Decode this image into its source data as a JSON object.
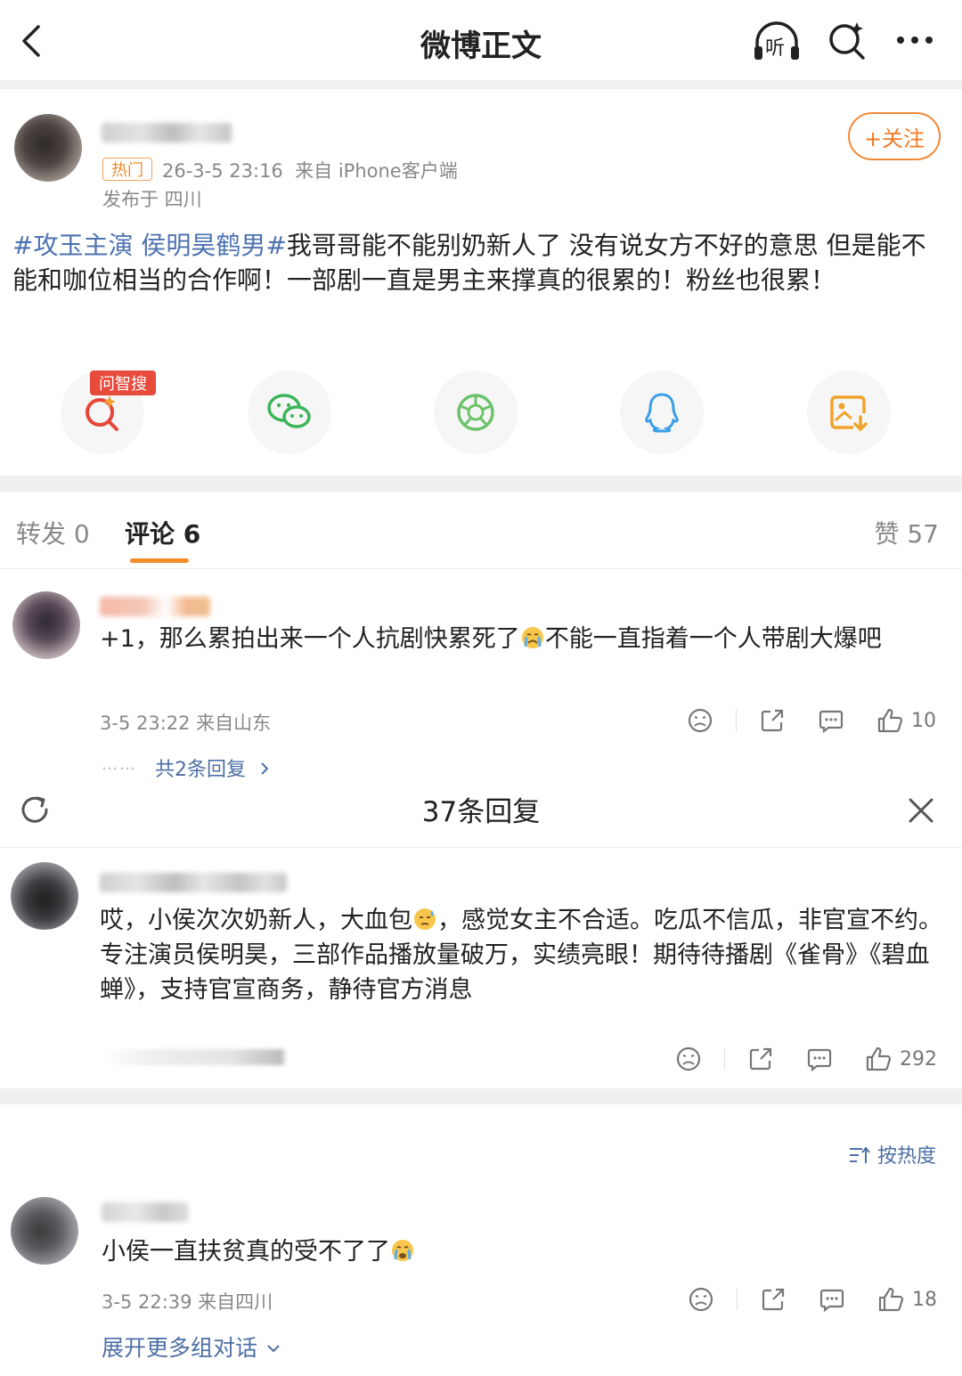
{
  "header": {
    "title": "微博正文",
    "listen_label": "听"
  },
  "post": {
    "follow_label": "+关注",
    "hot_tag": "热门",
    "time_source": "26-3-5 23:16  来自 iPhone客户端",
    "location": "发布于 四川",
    "topic": "#攻玉主演 侯明昊鹤男#",
    "body": "我哥哥能不能别奶新人了 没有说女方不好的意思 但是能不能和咖位相当的合作啊！一部剧一直是男主来撑真的很累的！粉丝也很累！"
  },
  "share": {
    "ai_badge": "问智搜",
    "items": [
      "ai-search",
      "wechat",
      "moments",
      "qq",
      "save-image"
    ]
  },
  "tabs": {
    "repost": "转发 0",
    "comment": "评论 6",
    "likes": "赞 57"
  },
  "comment1": {
    "text_a": "+1，那么累拍出来一个人抗剧快累死了",
    "text_b": "不能一直指着一个人带剧大爆吧",
    "meta": "3-5 23:22 来自山东",
    "likes": "10",
    "dots": "……",
    "replies": "共2条回复"
  },
  "reply_sheet": {
    "title": "37条回复"
  },
  "reply1": {
    "text_a": "哎，小侯次次奶新人，大血包",
    "text_b": "，感觉女主不合适。吃瓜不信瓜，非官宣不约。专注演员侯明昊，三部作品播放量破万，实绩亮眼！期待待播剧《雀骨》《碧血蝉》，支持官宣商务，静待官方消息",
    "likes": "292"
  },
  "sort": {
    "label": "按热度"
  },
  "comment2": {
    "text": "小侯一直扶贫真的受不了了",
    "meta": "3-5 22:39 来自四川",
    "likes": "18",
    "expand": "展开更多组对话"
  },
  "colors": {
    "accent": "#f28c28",
    "link": "#4c6fa5",
    "topic": "#4c72b0",
    "badge_red": "#e64b3c"
  }
}
